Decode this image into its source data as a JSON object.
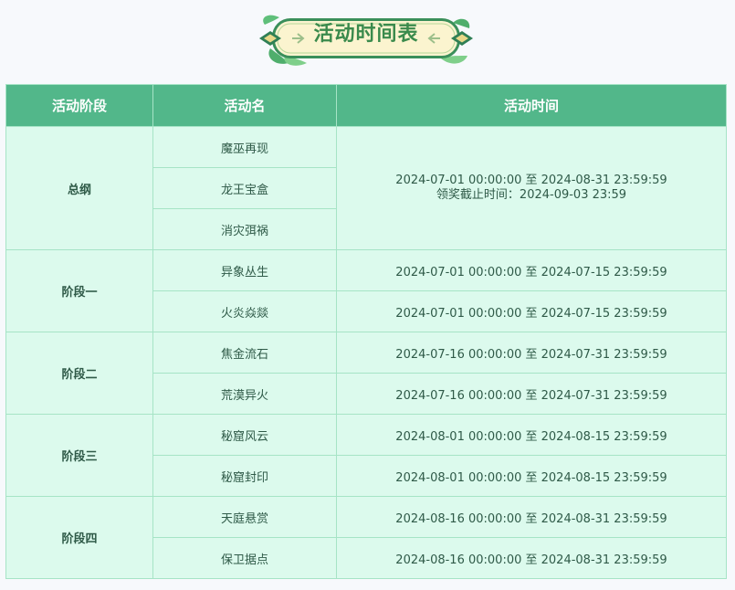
{
  "banner": {
    "title": "活动时间表"
  },
  "colors": {
    "header_bg": "#52b78a",
    "cell_bg": "#dcfaed",
    "border": "#a6e4c6",
    "banner_title": "#3a8a4c"
  },
  "table": {
    "headers": [
      "活动阶段",
      "活动名",
      "活动时间"
    ],
    "groups": [
      {
        "phase": "总纲",
        "rows": [
          {
            "name": "魔巫再现"
          },
          {
            "name": "龙王宝盒"
          },
          {
            "name": "消灾弭祸"
          }
        ],
        "shared_time": {
          "line1": "2024-07-01 00:00:00 至 2024-08-31 23:59:59",
          "line2": "领奖截止时间：2024-09-03 23:59"
        }
      },
      {
        "phase": "阶段一",
        "rows": [
          {
            "name": "异象丛生",
            "time": "2024-07-01 00:00:00 至 2024-07-15 23:59:59"
          },
          {
            "name": "火炎焱燚",
            "time": "2024-07-01 00:00:00 至 2024-07-15 23:59:59"
          }
        ]
      },
      {
        "phase": "阶段二",
        "rows": [
          {
            "name": "焦金流石",
            "time": "2024-07-16 00:00:00 至 2024-07-31 23:59:59"
          },
          {
            "name": "荒漠异火",
            "time": "2024-07-16 00:00:00 至 2024-07-31 23:59:59"
          }
        ]
      },
      {
        "phase": "阶段三",
        "rows": [
          {
            "name": "秘窟风云",
            "time": "2024-08-01 00:00:00 至 2024-08-15 23:59:59"
          },
          {
            "name": "秘窟封印",
            "time": "2024-08-01 00:00:00 至 2024-08-15 23:59:59"
          }
        ]
      },
      {
        "phase": "阶段四",
        "rows": [
          {
            "name": "天庭悬赏",
            "time": "2024-08-16 00:00:00 至 2024-08-31 23:59:59"
          },
          {
            "name": "保卫据点",
            "time": "2024-08-16 00:00:00 至 2024-08-31 23:59:59"
          }
        ]
      }
    ]
  }
}
